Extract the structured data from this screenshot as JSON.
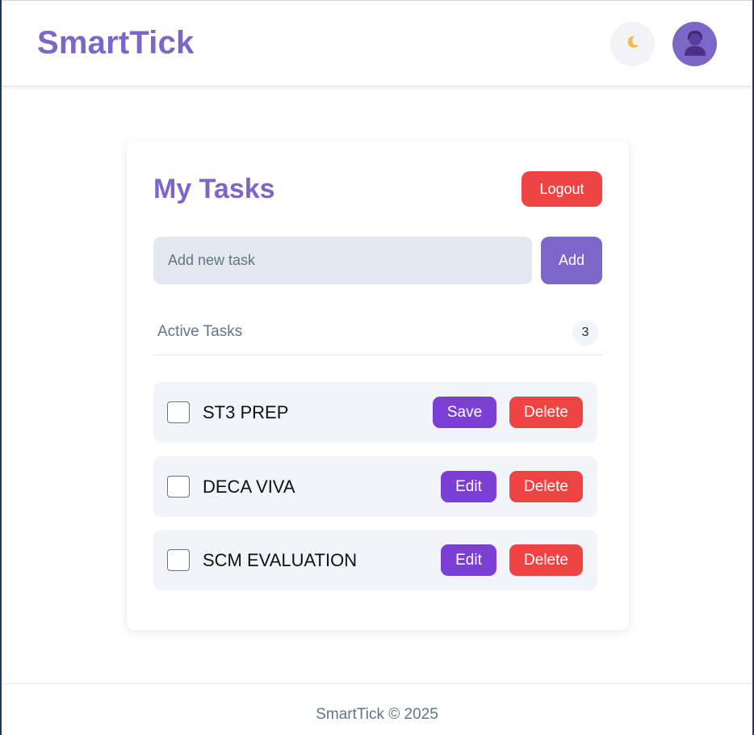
{
  "header": {
    "brand": "SmartTick",
    "theme_icon": "moon-icon",
    "avatar_icon": "user-avatar-icon"
  },
  "card": {
    "title": "My Tasks",
    "logout_label": "Logout",
    "input_placeholder": "Add new task",
    "input_value": "",
    "add_label": "Add",
    "section_label": "Active Tasks",
    "count": "3"
  },
  "tasks": [
    {
      "text": "ST3 PREP",
      "action_label": "Save",
      "delete_label": "Delete",
      "checked": false
    },
    {
      "text": "DECA VIVA",
      "action_label": "Edit",
      "delete_label": "Delete",
      "checked": false
    },
    {
      "text": "SCM EVALUATION",
      "action_label": "Edit",
      "delete_label": "Delete",
      "checked": false
    }
  ],
  "footer": {
    "text": "SmartTick © 2025"
  },
  "colors": {
    "brand": "#7c66c8",
    "danger": "#ef4444",
    "action": "#7b3fd6"
  }
}
